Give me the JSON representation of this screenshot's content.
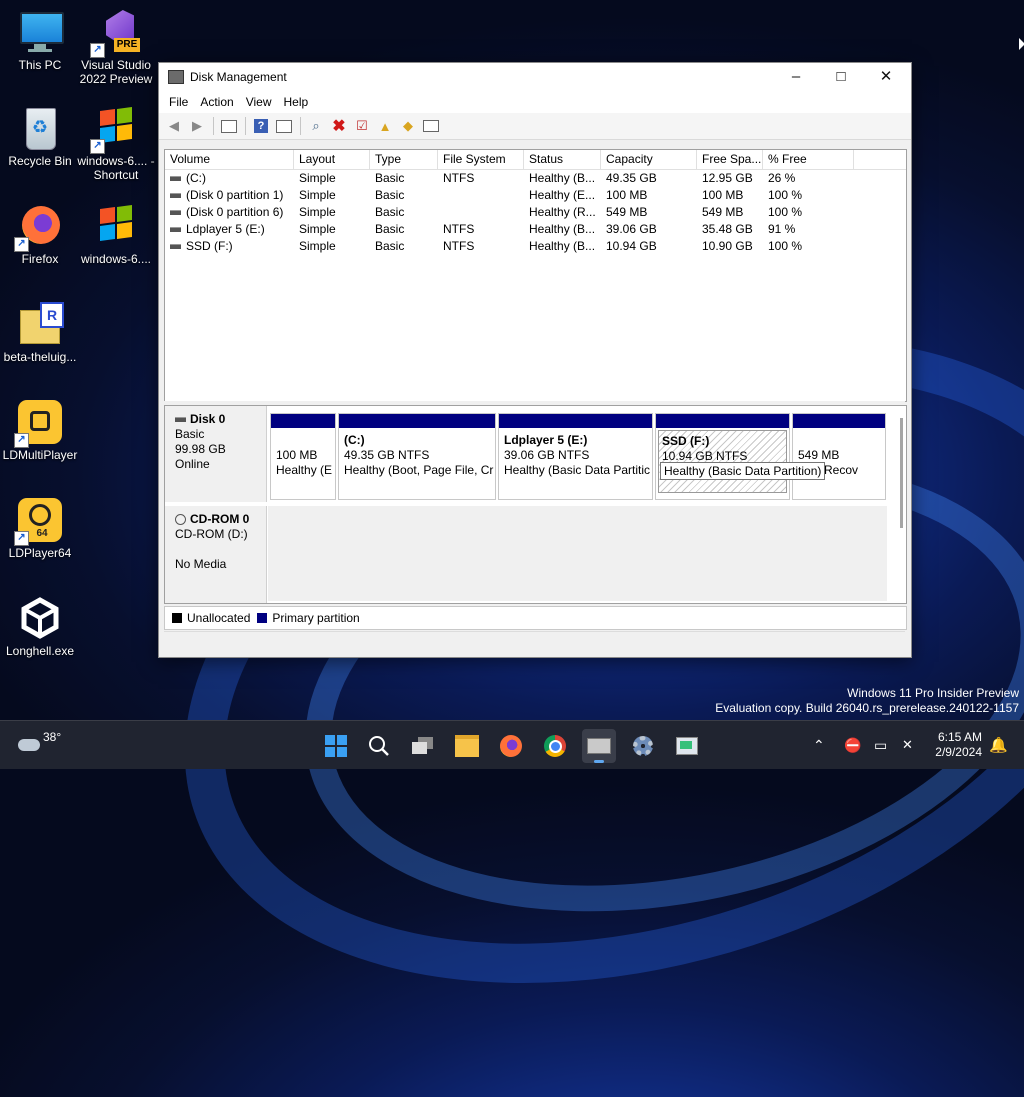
{
  "desktop": {
    "icons": [
      {
        "label": "This PC"
      },
      {
        "label": "Visual Studio 2022 Preview",
        "badge": "PRE"
      },
      {
        "label": "Recycle Bin"
      },
      {
        "label": "windows-6.... - Shortcut"
      },
      {
        "label": "Firefox"
      },
      {
        "label": "windows-6...."
      },
      {
        "label": "beta-theluig..."
      },
      {
        "label": "LDMultiPlayer"
      },
      {
        "label": "LDPlayer64",
        "badge": "64"
      },
      {
        "label": "Longhell.exe"
      }
    ]
  },
  "window": {
    "title": "Disk Management",
    "controls": {
      "minimize": "–",
      "maximize": "□",
      "close": "✕"
    },
    "menu": [
      "File",
      "Action",
      "Help",
      "View"
    ],
    "menu_ordered": [
      "File",
      "Action",
      "View",
      "Help"
    ],
    "volume_columns": [
      "Volume",
      "Layout",
      "Type",
      "File System",
      "Status",
      "Capacity",
      "Free Spa...",
      "% Free"
    ],
    "volumes": [
      {
        "volume": "(C:)",
        "layout": "Simple",
        "type": "Basic",
        "fs": "NTFS",
        "status": "Healthy (B...",
        "capacity": "49.35 GB",
        "free": "12.95 GB",
        "pct": "26 %"
      },
      {
        "volume": "(Disk 0 partition 1)",
        "layout": "Simple",
        "type": "Basic",
        "fs": "",
        "status": "Healthy (E...",
        "capacity": "100 MB",
        "free": "100 MB",
        "pct": "100 %"
      },
      {
        "volume": "(Disk 0 partition 6)",
        "layout": "Simple",
        "type": "Basic",
        "fs": "",
        "status": "Healthy (R...",
        "capacity": "549 MB",
        "free": "549 MB",
        "pct": "100 %"
      },
      {
        "volume": "Ldplayer 5 (E:)",
        "layout": "Simple",
        "type": "Basic",
        "fs": "NTFS",
        "status": "Healthy (B...",
        "capacity": "39.06 GB",
        "free": "35.48 GB",
        "pct": "91 %"
      },
      {
        "volume": "SSD (F:)",
        "layout": "Simple",
        "type": "Basic",
        "fs": "NTFS",
        "status": "Healthy (B...",
        "capacity": "10.94 GB",
        "free": "10.90 GB",
        "pct": "100 %"
      }
    ],
    "disk0": {
      "name": "Disk 0",
      "type": "Basic",
      "size": "99.98 GB",
      "state": "Online",
      "partitions": [
        {
          "title": "",
          "size": "100 MB",
          "status": "Healthy (E"
        },
        {
          "title": "(C:)",
          "size": "49.35 GB NTFS",
          "status": "Healthy (Boot, Page File, Cr"
        },
        {
          "title": "Ldplayer 5  (E:)",
          "size": "39.06 GB NTFS",
          "status": "Healthy (Basic Data Partitic"
        },
        {
          "title": "SSD  (F:)",
          "size": "10.94 GB NTFS",
          "status": "Healthy (Basic Data Partition)"
        },
        {
          "title": "",
          "size": "549 MB",
          "status": "lthy (Recov"
        }
      ]
    },
    "cdrom": {
      "name": "CD-ROM 0",
      "type": "CD-ROM (D:)",
      "media": "No Media"
    },
    "legend": {
      "unallocated": "Unallocated",
      "primary": "Primary partition",
      "unallocated_color": "#000000",
      "primary_color": "#000080"
    }
  },
  "watermark": {
    "line1": "Windows 11 Pro Insider Preview",
    "line2": "Evaluation copy. Build 26040.rs_prerelease.240122-1157"
  },
  "taskbar": {
    "weather_temp": "38°",
    "apps": [
      "start-icon",
      "search-icon",
      "task-view-icon",
      "file-explorer-icon",
      "firefox-icon",
      "chrome-icon",
      "disk-management-icon",
      "settings-icon",
      "screen-tool-icon"
    ],
    "time": "6:15 AM",
    "date": "2/9/2024"
  }
}
